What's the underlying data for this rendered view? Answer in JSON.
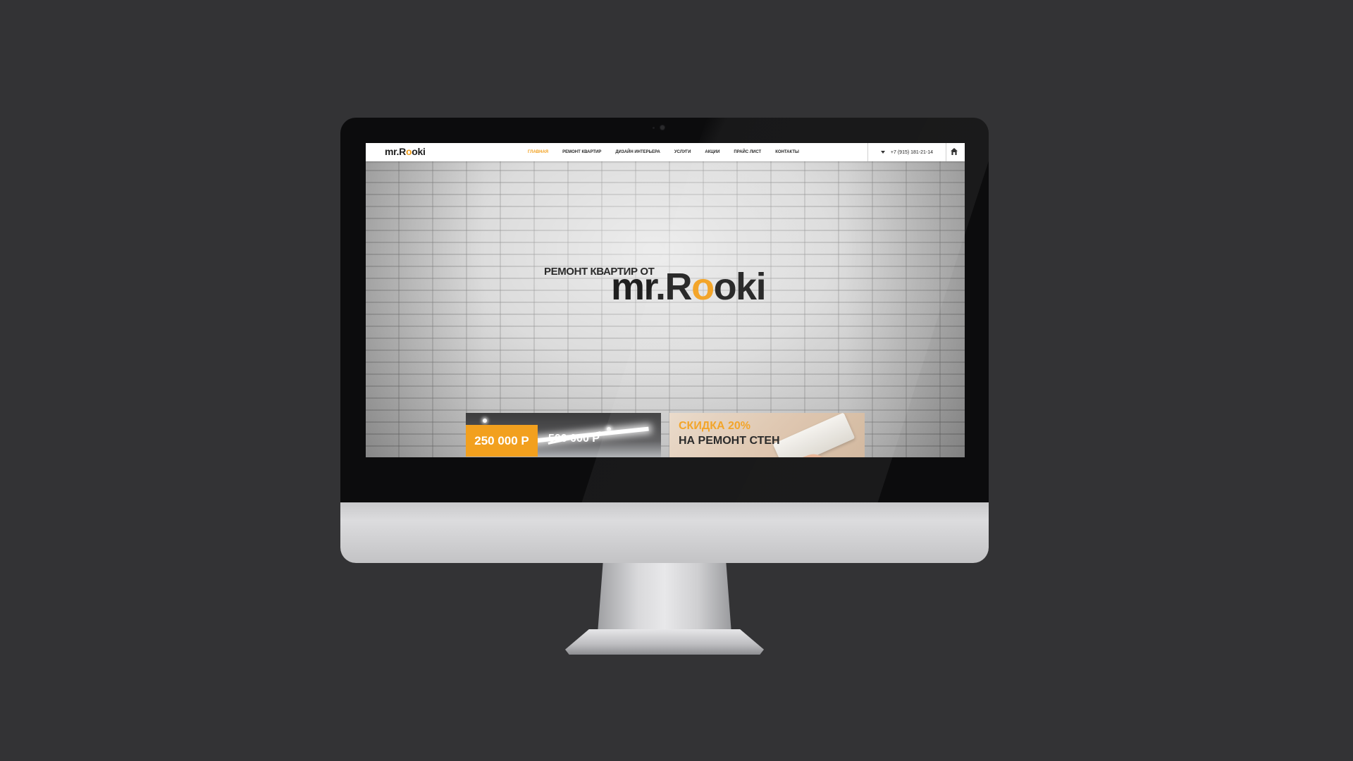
{
  "header": {
    "logo_prefix": "mr.R",
    "logo_o": "o",
    "logo_suffix": "oki",
    "nav": [
      {
        "label": "ГЛАВНАЯ",
        "active": true
      },
      {
        "label": "РЕМОНТ КВАРТИР"
      },
      {
        "label": "ДИЗАЙН ИНТЕРЬЕРА"
      },
      {
        "label": "УСЛУГИ"
      },
      {
        "label": "АКЦИИ"
      },
      {
        "label": "ПРАЙС ЛИСТ"
      },
      {
        "label": "КОНТАКТЫ"
      }
    ],
    "phone": "+7 (915) 181-21-14",
    "accent_color": "#f2a01e"
  },
  "hero": {
    "subtitle": "РЕМОНТ КВАРТИР ОТ",
    "title_prefix": "mr.R",
    "title_o": "o",
    "title_suffix": "oki"
  },
  "promos": {
    "price_new": "250 000 Р",
    "price_old": "500 000 Р",
    "discount_line1": "СКИДКА 20%",
    "discount_line2": "НА РЕМОНТ СТЕН"
  }
}
